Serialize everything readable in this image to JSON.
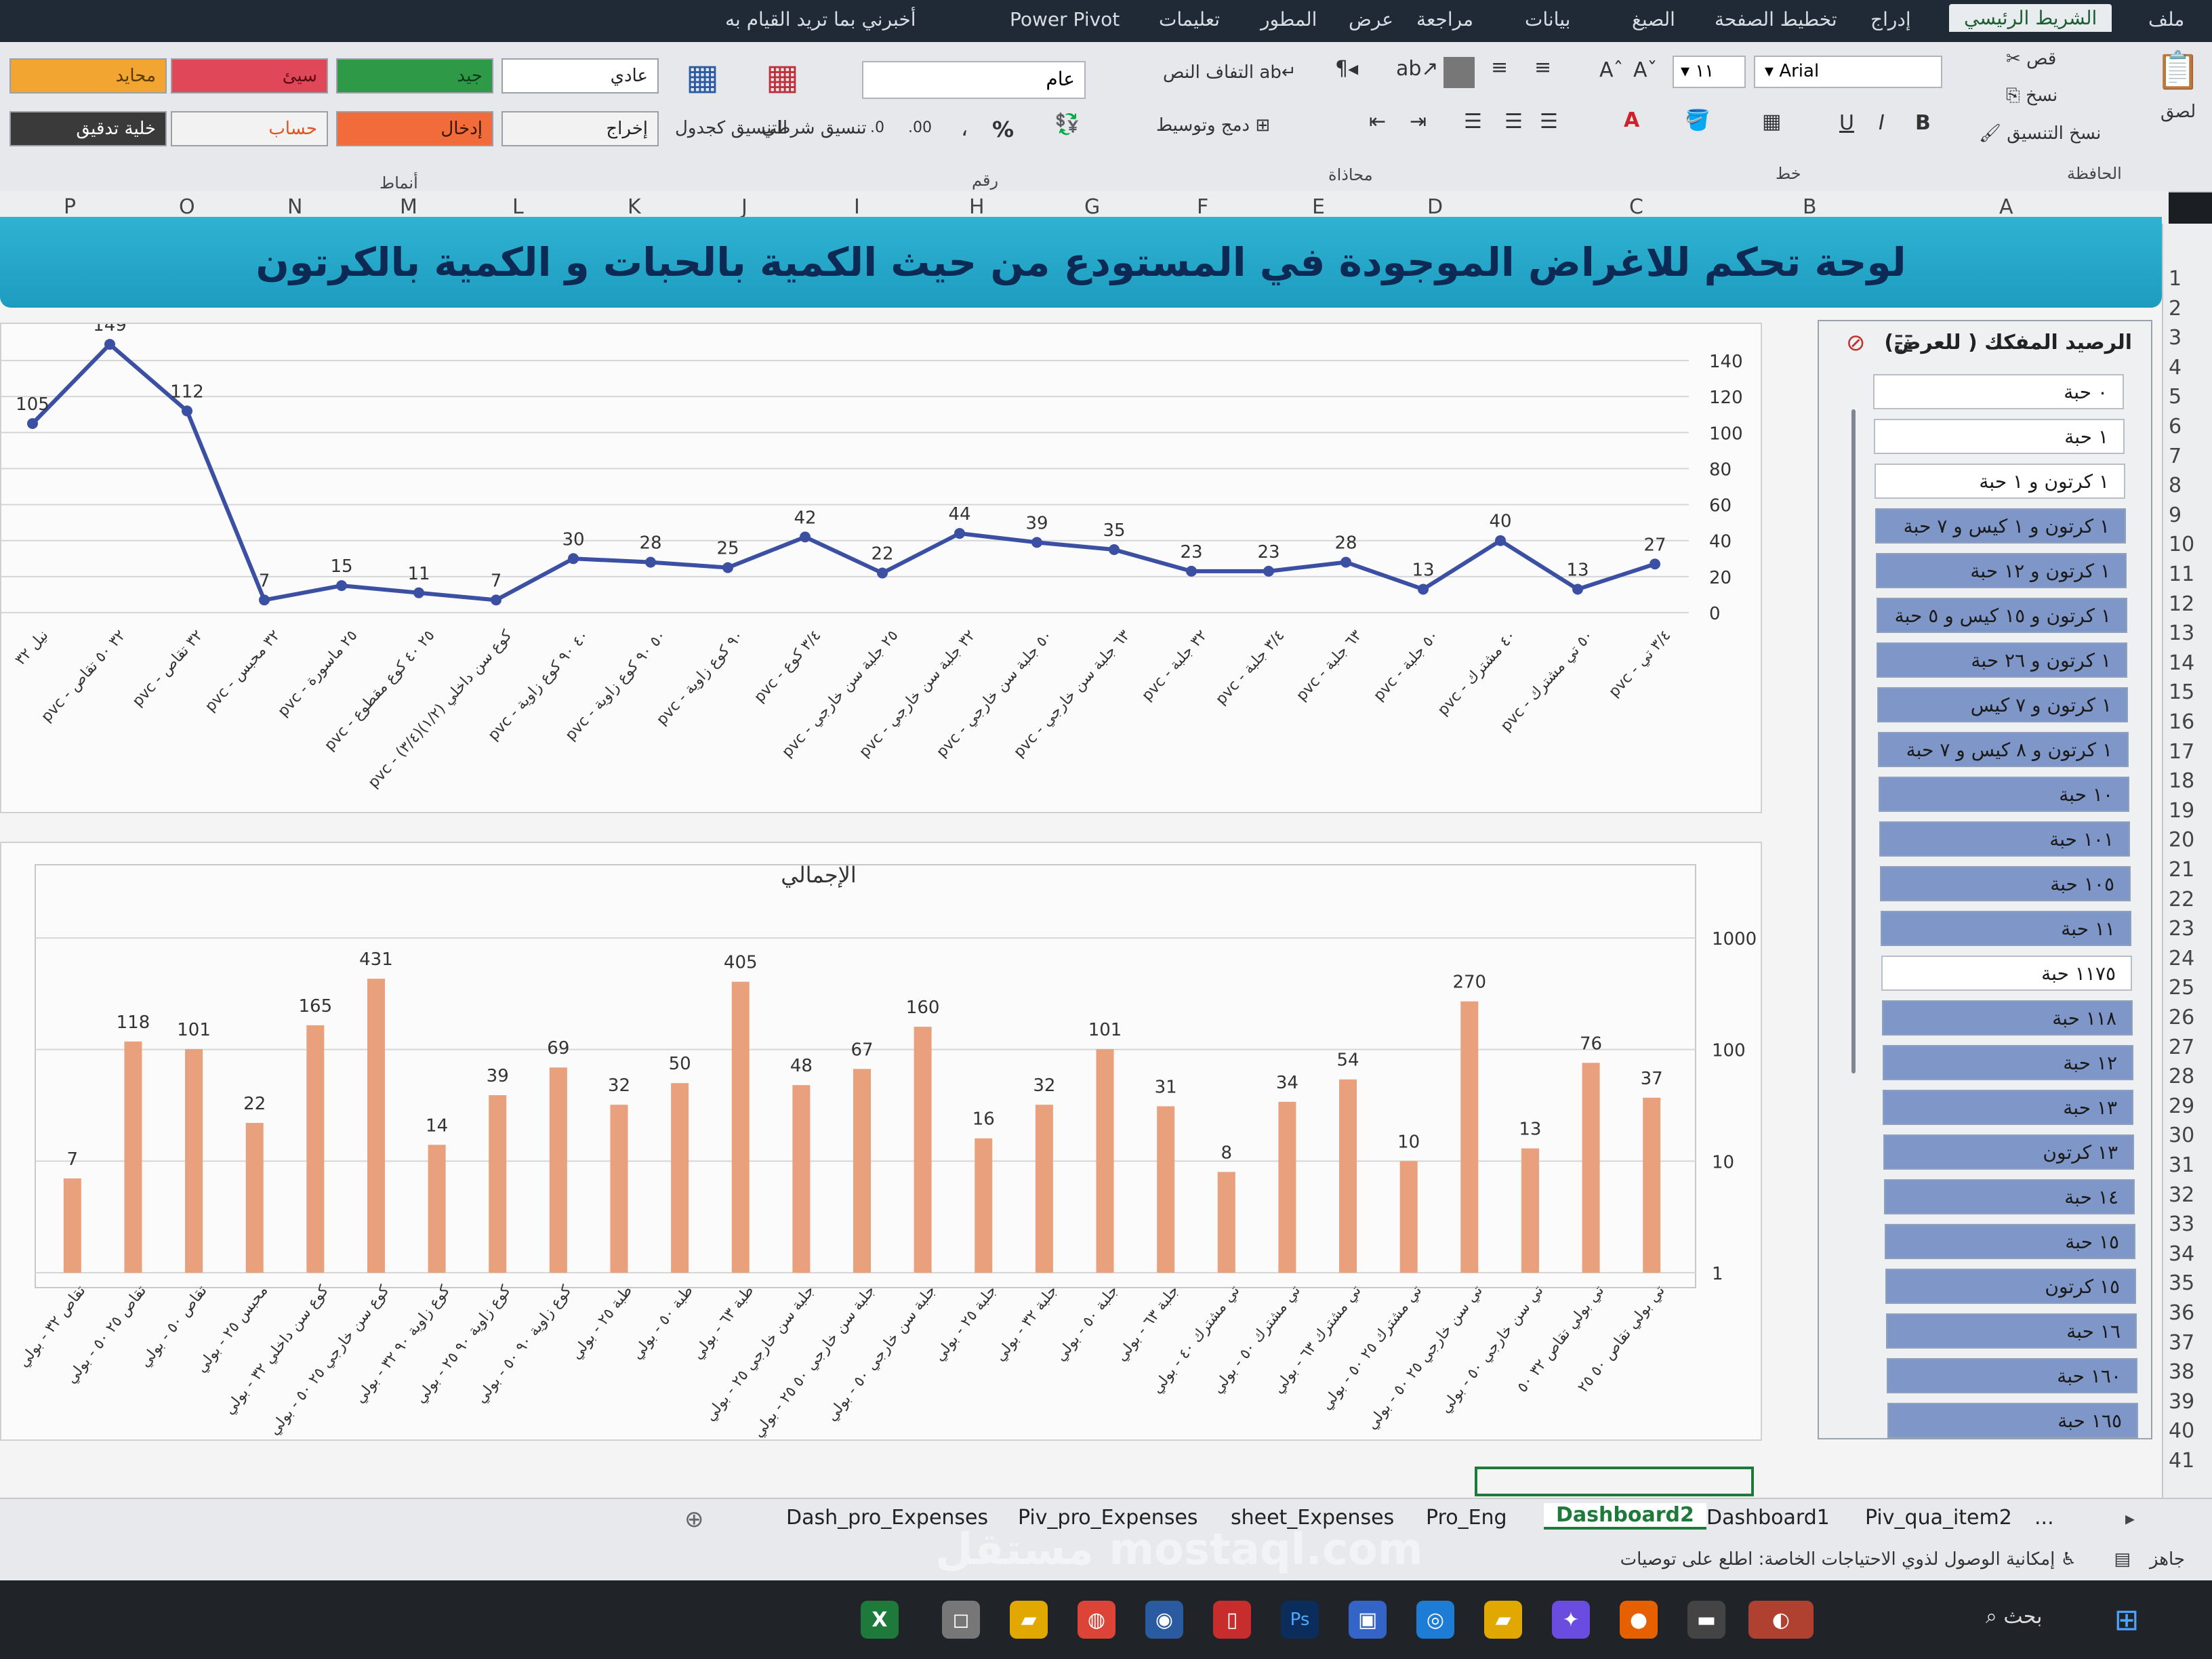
{
  "menu": {
    "tabs": [
      "ملف",
      "الشريط الرئيسي",
      "إدراج",
      "تخطيط الصفحة",
      "الصيغ",
      "بيانات",
      "مراجعة",
      "عرض",
      "المطور",
      "تعليمات",
      "Power Pivot",
      "أخبرني بما تريد القيام به"
    ]
  },
  "ribbon": {
    "clipboard": {
      "paste": "لصق",
      "cut": "قص",
      "copy": "نسخ",
      "format_painter": "نسخ التنسيق",
      "group": "الحافظة"
    },
    "font": {
      "name": "Arial",
      "size": "١١",
      "group": "خط",
      "bold": "B",
      "italic": "I",
      "underline": "U"
    },
    "alignment": {
      "wrap": "التفاف النص",
      "merge": "دمج وتوسيط",
      "group": "محاذاة"
    },
    "number": {
      "format": "عام",
      "group": "رقم",
      "percent": "%",
      "comma": "،",
      "inc": ".00",
      "dec": ".0"
    },
    "styles": {
      "conditional": "تنسيق شرطي",
      "as_table": "التنسيق كجدول",
      "group": "أنماط",
      "cells": [
        {
          "label": "عادي",
          "bg": "#ffffff",
          "fg": "#222222"
        },
        {
          "label": "جيد",
          "bg": "#2e9a47",
          "fg": "#0b3d18"
        },
        {
          "label": "سيئ",
          "bg": "#e0485a",
          "fg": "#5a0b14"
        },
        {
          "label": "محايد",
          "bg": "#f2a531",
          "fg": "#5a3a00"
        },
        {
          "label": "إخراج",
          "bg": "#f2f2f2",
          "fg": "#222222"
        },
        {
          "label": "إدخال",
          "bg": "#f26b3a",
          "fg": "#3a1400"
        },
        {
          "label": "حساب",
          "bg": "#f2f2f2",
          "fg": "#e0531f"
        },
        {
          "label": "خلية تدقيق",
          "bg": "#3a3a3a",
          "fg": "#ffffff"
        }
      ]
    }
  },
  "columns": [
    "A",
    "B",
    "C",
    "D",
    "E",
    "F",
    "G",
    "H",
    "I",
    "J",
    "K",
    "L",
    "M",
    "N",
    "O",
    "P"
  ],
  "rows": [
    "1",
    "2",
    "3",
    "4",
    "5",
    "6",
    "7",
    "8",
    "9",
    "10",
    "11",
    "12",
    "13",
    "14",
    "15",
    "16",
    "17",
    "18",
    "19",
    "20",
    "21",
    "22",
    "23",
    "24",
    "25",
    "26",
    "27",
    "28",
    "29",
    "30",
    "31",
    "32",
    "33",
    "34",
    "35",
    "36",
    "37",
    "38",
    "39",
    "40",
    "41"
  ],
  "banner": {
    "title": "لوحة تحكم للاغراض الموجودة في المستودع من حيث الكمية بالحبات و الكمية بالكرتون"
  },
  "chart_data": [
    {
      "type": "line",
      "title": "",
      "ylim": [
        0,
        140
      ],
      "yticks": [
        0,
        20,
        40,
        60,
        80,
        100,
        120,
        140
      ],
      "color": "#3b4fa3",
      "categories": [
        "نيل ٣٢",
        "pvc - ٣٢ ٥٠ تقاص",
        "pvc - ٣٢ تقاص",
        "pvc - ٣٢ محبس",
        "pvc - ٢٥ ماسورة",
        "pvc - ٢٥ ٤٠ كوع مقطوع",
        "pvc - (٣/٤)(١/٢) كوع سن داخلي",
        "pvc - ٤٠ ٩٠ كوع زاوية",
        "pvc - ٥٠ ٩٠ كوع زاوية",
        "pvc - ٩٠ كوع زاوية",
        "pvc - ٣/٤ كوع",
        "pvc - ٢٥ جلبة سن خارجي",
        "pvc - ٣٢ جلبة سن خارجي",
        "pvc - ٥٠ جلبة سن خارجي",
        "pvc - ٦٣ جلبة سن خارجي",
        "pvc - ٣٢ جلبة",
        "pvc - ٣/٤ جلبة",
        "pvc - ٦٣ جلبة",
        "pvc - ٥٠ جلبة",
        "pvc - ٤٠ مشترك",
        "pvc - ٥٠ تي مشترك",
        "pvc - ٣/٤ تي"
      ],
      "values": [
        105,
        149,
        112,
        7,
        15,
        11,
        7,
        30,
        28,
        25,
        42,
        22,
        44,
        39,
        35,
        23,
        23,
        28,
        13,
        40,
        13,
        27
      ]
    },
    {
      "type": "bar",
      "title": "الإجمالي",
      "scale": "log",
      "ylim": [
        1,
        1000
      ],
      "yticks": [
        1,
        10,
        100,
        1000
      ],
      "color": "#e8a07d",
      "categories": [
        "تقاص ٣٢ - بولي",
        "تقاص ٢٥ ٥٠ - بولي",
        "تقاص ٥٠ - بولي",
        "محبس ٢٥ - بولي",
        "كوع سن داخلي ٣٢ - بولي",
        "كوع سن خارجي ٢٥ ٥٠ - بولي",
        "كوع زاوية ٩٠ ٣٢ - بولي",
        "كوع زاوية ٩٠ ٢٥ - بولي",
        "كوع زاوية ٩٠ ٥٠ - بولي",
        "طبة ٢٥ - بولي",
        "طبة ٥٠ - بولي",
        "طبة ٦٣ - بولي",
        "جلبة سن خارجي ٢٥ - بولي",
        "جلبة سن خارجي ٥٠ ٢٥ - بولي",
        "جلبة سن خارجي ٥٠ - بولي",
        "جلبة ٢٥ - بولي",
        "جلبة ٣٢ - بولي",
        "جلبة ٥٠ - بولي",
        "جلبة ٦٣ - بولي",
        "تي مشترك ٤٠ - بولي",
        "تي مشترك ٥٠ - بولي",
        "تي مشترك ٦٣ - بولي",
        "تي مشترك ٢٥ ٥٠ - بولي",
        "تي سن خارجي ٢٥ ٥٠ - بولي",
        "تي سن خارجي ٥٠ - بولي",
        "تي بولي تقاص ٣٢ ٥٠",
        "تي بولي تقاص ٥٠ ٢٥"
      ],
      "values": [
        7,
        118,
        101,
        22,
        165,
        431,
        14,
        39,
        69,
        32,
        50,
        405,
        48,
        67,
        160,
        16,
        32,
        101,
        31,
        8,
        34,
        54,
        10,
        270,
        13,
        76,
        37
      ]
    }
  ],
  "slicer": {
    "title": "الرصيد المفكك ( للعرض)",
    "items": [
      {
        "label": "٠ حبة",
        "sel": false
      },
      {
        "label": "١ حبة",
        "sel": false
      },
      {
        "label": "١ كرتون و ١ حبة",
        "sel": false
      },
      {
        "label": "١ كرتون و ١ كيس و ٧ حبة",
        "sel": true
      },
      {
        "label": "١ كرتون و ١٢ حبة",
        "sel": true
      },
      {
        "label": "١ كرتون و ١٥ كيس و ٥ حبة",
        "sel": true
      },
      {
        "label": "١ كرتون و ٢٦ حبة",
        "sel": true
      },
      {
        "label": "١ كرتون و ٧ كيس",
        "sel": true
      },
      {
        "label": "١ كرتون و ٨ كيس و ٧ حبة",
        "sel": true
      },
      {
        "label": "١٠ حبة",
        "sel": true
      },
      {
        "label": "١٠١ حبة",
        "sel": true
      },
      {
        "label": "١٠٥ حبة",
        "sel": true
      },
      {
        "label": "١١ حبة",
        "sel": true
      },
      {
        "label": "١١٧٥ حبة",
        "sel": false
      },
      {
        "label": "١١٨ حبة",
        "sel": true
      },
      {
        "label": "١٢ حبة",
        "sel": true
      },
      {
        "label": "١٣ حبة",
        "sel": true
      },
      {
        "label": "١٣ كرتون",
        "sel": true
      },
      {
        "label": "١٤ حبة",
        "sel": true
      },
      {
        "label": "١٥ حبة",
        "sel": true
      },
      {
        "label": "١٥ كرتون",
        "sel": true
      },
      {
        "label": "١٦ حبة",
        "sel": true
      },
      {
        "label": "١٦٠ حبة",
        "sel": true
      },
      {
        "label": "١٦٥ حبة",
        "sel": true
      }
    ]
  },
  "sheet_tabs": {
    "tabs": [
      "...",
      "Piv_qua_item2",
      "Dashboard1",
      "Dashboard2",
      "Pro_Eng",
      "sheet_Expenses",
      "Piv_pro_Expenses",
      "Dash_pro_Expenses"
    ],
    "active": "Dashboard2"
  },
  "status": {
    "ready": "جاهز",
    "accessibility": "إمكانية الوصول لذوي الاحتياجات الخاصة: اطلع على توصيات"
  },
  "taskbar": {
    "search": "بحث"
  },
  "watermark": "مستقل mostaql.com"
}
